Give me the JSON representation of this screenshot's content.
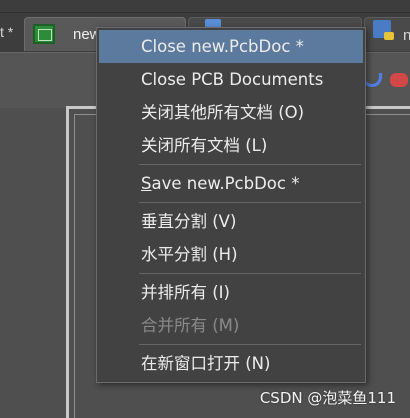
{
  "tabs": {
    "left_fragment": "t *",
    "active_label": "new",
    "other_label": "nev"
  },
  "context_menu": {
    "items": [
      {
        "label": "Close new.PcbDoc *",
        "state": "highlighted"
      },
      {
        "label": "Close PCB Documents",
        "state": "normal"
      },
      {
        "label": "关闭其他所有文档 (O)",
        "state": "normal"
      },
      {
        "label": "关闭所有文档 (L)",
        "state": "normal"
      },
      {
        "label": "Save new.PcbDoc *",
        "state": "normal"
      },
      {
        "label": "垂直分割 (V)",
        "state": "normal"
      },
      {
        "label": "水平分割 (H)",
        "state": "normal"
      },
      {
        "label": "并排所有 (I)",
        "state": "normal"
      },
      {
        "label": "合并所有 (M)",
        "state": "disabled"
      },
      {
        "label": "在新窗口打开 (N)",
        "state": "normal"
      }
    ]
  },
  "watermark": "CSDN @泡菜鱼111",
  "colors": {
    "menu_background": "#424242",
    "menu_highlight": "#5b7a9d",
    "disabled_text": "#8a8a8a",
    "board_frame": "#c9c9c9"
  },
  "icons": {
    "active_tab": "pcb-document-icon",
    "other_tab": "schematic-document-icon",
    "toolbar": [
      "redo-icon",
      "red-tool-icon"
    ]
  }
}
